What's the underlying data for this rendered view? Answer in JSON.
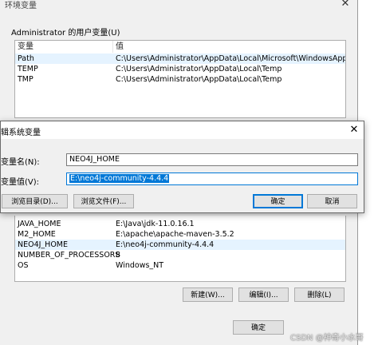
{
  "back_window": {
    "title": "环境变量",
    "user_group_label": "Administrator 的用户变量(U)",
    "columns": [
      "变量",
      "值"
    ],
    "user_vars": [
      {
        "name": "Path",
        "value": "C:\\Users\\Administrator\\AppData\\Local\\Microsoft\\WindowsApps;"
      },
      {
        "name": "TEMP",
        "value": "C:\\Users\\Administrator\\AppData\\Local\\Temp"
      },
      {
        "name": "TMP",
        "value": "C:\\Users\\Administrator\\AppData\\Local\\Temp"
      }
    ],
    "system_vars": [
      {
        "name": "JAVA_HOME",
        "value": "E:\\Java\\jdk-11.0.16.1"
      },
      {
        "name": "M2_HOME",
        "value": "E:\\apache\\apache-maven-3.5.2"
      },
      {
        "name": "NEO4J_HOME",
        "value": "E:\\neo4j-community-4.4.4"
      },
      {
        "name": "NUMBER_OF_PROCESSORS",
        "value": "8"
      },
      {
        "name": "OS",
        "value": "Windows_NT"
      }
    ],
    "buttons": {
      "new": "新建(W)...",
      "edit": "编辑(I)...",
      "delete": "删除(L)",
      "ok": "确定"
    }
  },
  "dialog": {
    "title": "辑系统变量",
    "name_label": "变量名(N):",
    "value_label": "变量值(V):",
    "name_value": "NEO4J_HOME",
    "value_value": "E:\\neo4j-community-4.4.4",
    "buttons": {
      "browse_dir": "浏览目录(D)...",
      "browse_file": "浏览文件(F)...",
      "ok": "确定",
      "cancel": "取消"
    }
  },
  "watermark": "CSDN @神奇小水哥",
  "colors": {
    "accent": "#0078d7",
    "selection": "#e5f3ff"
  }
}
